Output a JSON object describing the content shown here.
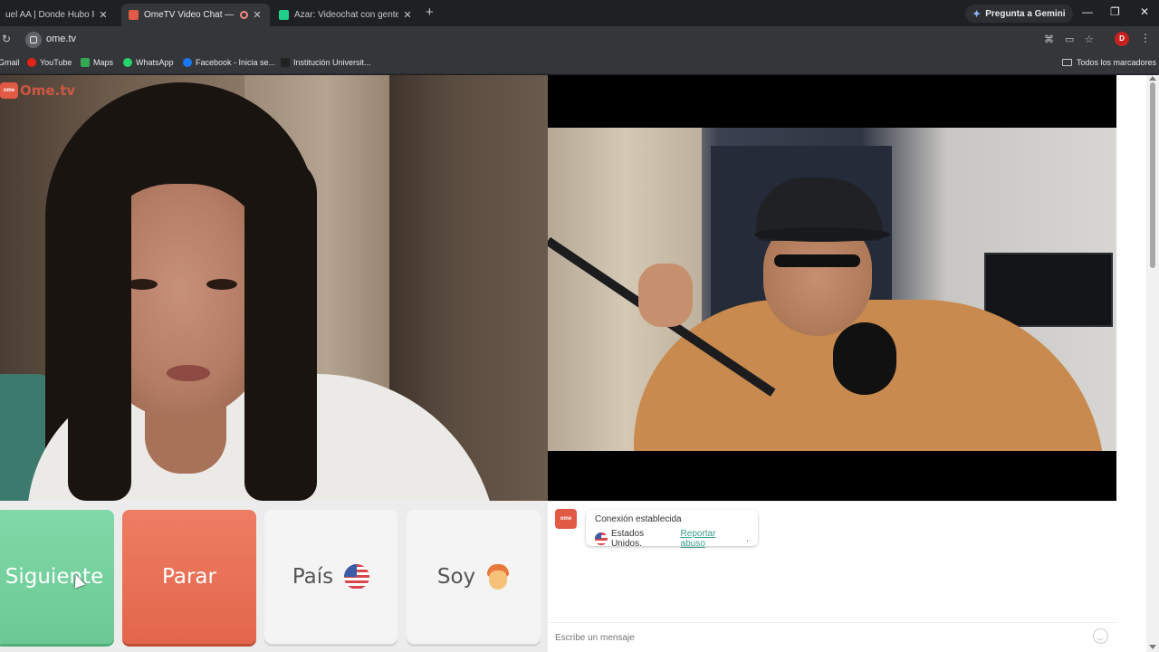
{
  "browser": {
    "tabs": [
      {
        "title": "uel AA | Donde Hubo Fuego",
        "close": "✕"
      },
      {
        "title": "OmeTV Video Chat — Ome",
        "close": "✕"
      },
      {
        "title": "Azar: Videochat con gente nue",
        "close": "✕"
      }
    ],
    "new_tab": "+",
    "gemini_label": "Pregunta a Gemini",
    "url": "ome.tv",
    "profile_initial": "D",
    "bookmarks": [
      "Gmail",
      "YouTube",
      "Maps",
      "WhatsApp",
      "Facebook - Inicia se...",
      "Institución Universit..."
    ],
    "all_bookmarks": "Todos los marcadores"
  },
  "colors": {
    "brand": "#e15a44",
    "next": "#7fd9a8",
    "stop": "#ee7d63",
    "link": "#3b9c8c"
  },
  "page": {
    "logo_text": "Ome.tv",
    "logo_icon": "ome",
    "buttons": {
      "next": "Siguiente",
      "stop": "Parar",
      "country": "País",
      "gender": "Soy"
    },
    "chat": {
      "avatar": "ome",
      "status": "Conexión establecida",
      "country": "Estados Unidos.",
      "report": "Reportar abuso",
      "period": ".",
      "placeholder": "Escribe un mensaje"
    }
  }
}
